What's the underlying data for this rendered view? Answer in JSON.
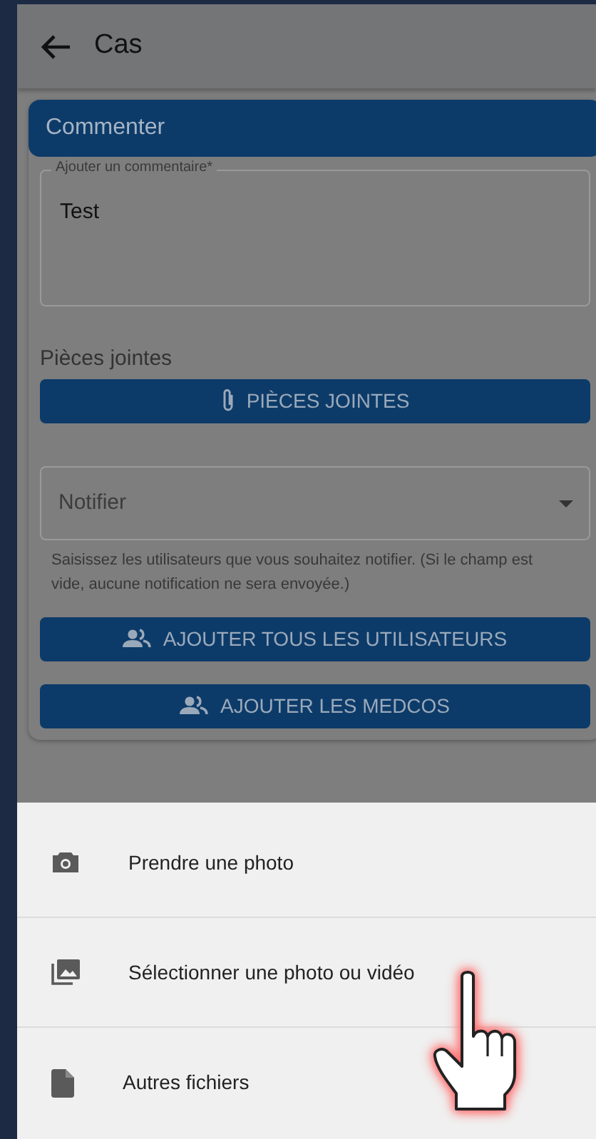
{
  "header": {
    "title": "Cas"
  },
  "form": {
    "section_title": "Commenter",
    "comment": {
      "label": "Ajouter un commentaire*",
      "value": "Test"
    },
    "attachments_label": "Pièces jointes",
    "attachments_button": "PIÈCES JOINTES",
    "notify": {
      "placeholder": "Notifier",
      "help": "Saisissez les utilisateurs que vous souhaitez notifier. (Si le champ est vide, aucune notification ne sera envoyée.)"
    },
    "buttons": [
      "AJOUTER TOUS LES UTILISATEURS",
      "AJOUTER LES MEDCOS"
    ]
  },
  "sheet": {
    "items": [
      {
        "kind": "camera",
        "label": "Prendre une photo"
      },
      {
        "kind": "gallery",
        "label": "Sélectionner une photo ou vidéo"
      },
      {
        "kind": "file",
        "label": "Autres fichiers"
      }
    ]
  }
}
